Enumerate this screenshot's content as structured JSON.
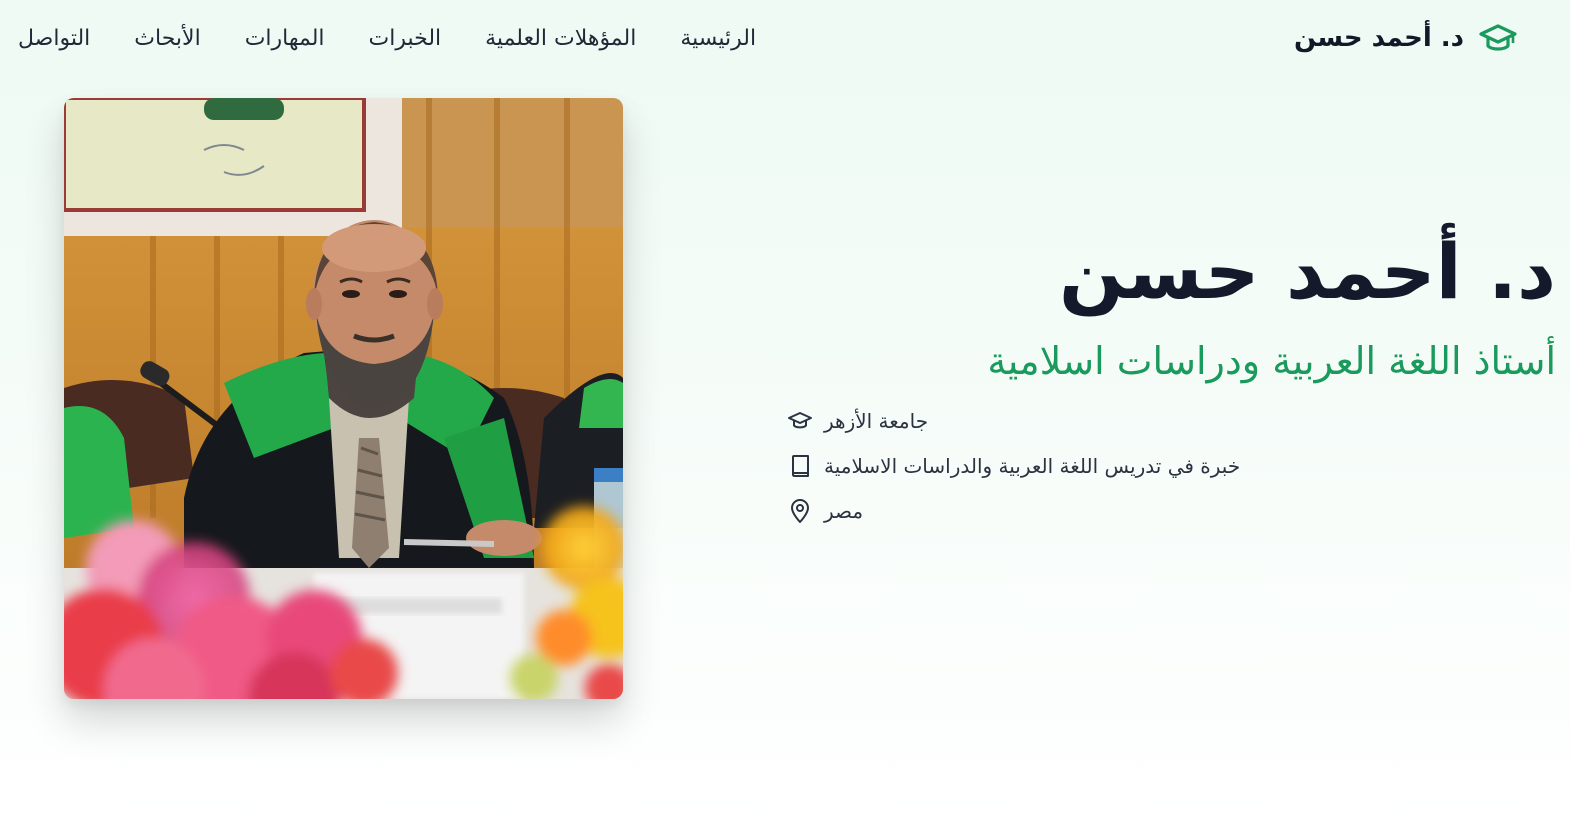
{
  "brand": {
    "name": "د. أحمد حسن",
    "icon": "graduation-cap-icon",
    "accent_color": "#1a9a5c"
  },
  "nav": {
    "links": [
      {
        "label": "الرئيسية"
      },
      {
        "label": "المؤهلات العلمية"
      },
      {
        "label": "الخبرات"
      },
      {
        "label": "المهارات"
      },
      {
        "label": "الأبحاث"
      },
      {
        "label": "التواصل"
      }
    ]
  },
  "hero": {
    "title": "د. أحمد حسن",
    "subtitle": "أستاذ اللغة العربية ودراسات اسلامية",
    "info": [
      {
        "icon": "graduation-cap-icon",
        "text": "جامعة الأزهر"
      },
      {
        "icon": "book-icon",
        "text": "خبرة في تدريس اللغة العربية والدراسات الاسلامية"
      },
      {
        "icon": "map-pin-icon",
        "text": "مصر"
      }
    ]
  },
  "photo": {
    "subject": "profile-photo"
  }
}
